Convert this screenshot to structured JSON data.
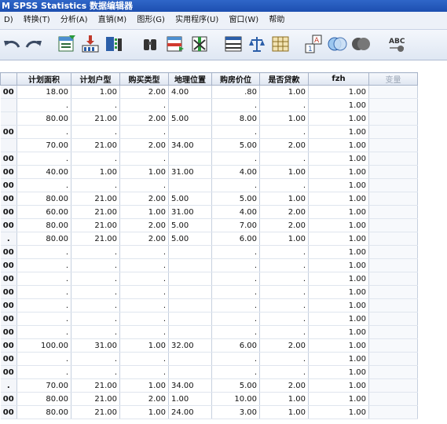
{
  "window": {
    "title": "M SPSS Statistics 数据编辑器"
  },
  "menu": [
    "D)",
    "转换(T)",
    "分析(A)",
    "直销(M)",
    "图形(G)",
    "实用程序(U)",
    "窗口(W)",
    "帮助"
  ],
  "toolbar": [
    {
      "name": "undo-icon"
    },
    {
      "name": "redo-icon"
    },
    {
      "name": "goto-case-icon"
    },
    {
      "name": "goto-variable-icon"
    },
    {
      "name": "variables-icon"
    },
    {
      "name": "find-icon"
    },
    {
      "name": "insert-cases-icon"
    },
    {
      "name": "insert-variable-icon"
    },
    {
      "name": "split-file-icon"
    },
    {
      "name": "weight-cases-icon"
    },
    {
      "name": "select-cases-icon"
    },
    {
      "name": "value-labels-icon"
    },
    {
      "name": "use-sets-icon"
    },
    {
      "name": "show-all-variables-icon"
    },
    {
      "name": "spell-check-icon"
    }
  ],
  "colors": {
    "title_bg": "#2f66c8",
    "header_bg": "#dfe6f1",
    "grid_line": "#c6d0df"
  },
  "columns": [
    "",
    "计划面积",
    "计划户型",
    "购买类型",
    "地理位置",
    "购房价位",
    "是否贷款",
    "fzh",
    "变量"
  ],
  "rows": [
    [
      "00",
      "18.00",
      "1.00",
      "2.00",
      "4.00",
      ".80",
      "1.00",
      "1.00",
      ""
    ],
    [
      "",
      ".",
      ".",
      ".",
      "",
      ".",
      ".",
      "1.00",
      ""
    ],
    [
      "",
      "80.00",
      "21.00",
      "2.00",
      "5.00",
      "8.00",
      "1.00",
      "1.00",
      ""
    ],
    [
      "00",
      ".",
      ".",
      ".",
      "",
      ".",
      ".",
      "1.00",
      ""
    ],
    [
      "",
      "70.00",
      "21.00",
      "2.00",
      "34.00",
      "5.00",
      "2.00",
      "1.00",
      ""
    ],
    [
      "00",
      ".",
      ".",
      ".",
      "",
      ".",
      ".",
      "1.00",
      ""
    ],
    [
      "00",
      "40.00",
      "1.00",
      "1.00",
      "31.00",
      "4.00",
      "1.00",
      "1.00",
      ""
    ],
    [
      "00",
      ".",
      ".",
      ".",
      "",
      ".",
      ".",
      "1.00",
      ""
    ],
    [
      "00",
      "80.00",
      "21.00",
      "2.00",
      "5.00",
      "5.00",
      "1.00",
      "1.00",
      ""
    ],
    [
      "00",
      "60.00",
      "21.00",
      "1.00",
      "31.00",
      "4.00",
      "2.00",
      "1.00",
      ""
    ],
    [
      "00",
      "80.00",
      "21.00",
      "2.00",
      "5.00",
      "7.00",
      "2.00",
      "1.00",
      ""
    ],
    [
      ".",
      "80.00",
      "21.00",
      "2.00",
      "5.00",
      "6.00",
      "1.00",
      "1.00",
      ""
    ],
    [
      "00",
      ".",
      ".",
      ".",
      "",
      ".",
      ".",
      "1.00",
      ""
    ],
    [
      "00",
      ".",
      ".",
      ".",
      "",
      ".",
      ".",
      "1.00",
      ""
    ],
    [
      "00",
      ".",
      ".",
      ".",
      "",
      ".",
      ".",
      "1.00",
      ""
    ],
    [
      "00",
      ".",
      ".",
      ".",
      "",
      ".",
      ".",
      "1.00",
      ""
    ],
    [
      "00",
      ".",
      ".",
      ".",
      "",
      ".",
      ".",
      "1.00",
      ""
    ],
    [
      "00",
      ".",
      ".",
      ".",
      "",
      ".",
      ".",
      "1.00",
      ""
    ],
    [
      "00",
      ".",
      ".",
      ".",
      "",
      ".",
      ".",
      "1.00",
      ""
    ],
    [
      "00",
      "100.00",
      "31.00",
      "1.00",
      "32.00",
      "6.00",
      "2.00",
      "1.00",
      ""
    ],
    [
      "00",
      ".",
      ".",
      ".",
      "",
      ".",
      ".",
      "1.00",
      ""
    ],
    [
      "00",
      ".",
      ".",
      ".",
      "",
      ".",
      ".",
      "1.00",
      ""
    ],
    [
      ".",
      "70.00",
      "21.00",
      "1.00",
      "34.00",
      "5.00",
      "2.00",
      "1.00",
      ""
    ],
    [
      "00",
      "80.00",
      "21.00",
      "2.00",
      "1.00",
      "10.00",
      "1.00",
      "1.00",
      ""
    ],
    [
      "00",
      "80.00",
      "21.00",
      "1.00",
      "24.00",
      "3.00",
      "1.00",
      "1.00",
      ""
    ]
  ]
}
